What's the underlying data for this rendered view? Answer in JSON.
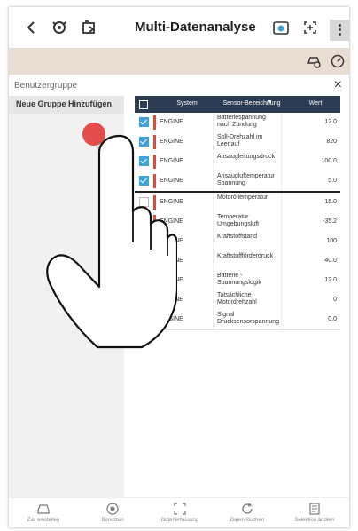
{
  "topbar": {
    "title": "Multi-Datenanalyse",
    "icons": [
      "back-icon",
      "engine-icon",
      "car-icon",
      "vci-icon",
      "screenshot-icon",
      "more-icon"
    ]
  },
  "subbar": {
    "icons": [
      "car-search-icon",
      "speedometer-icon"
    ]
  },
  "panel": {
    "title": "Benutzergruppe",
    "close": "×"
  },
  "group": {
    "add_label": "Neue Gruppe Hinzufügen"
  },
  "table": {
    "columns": {
      "system": "System",
      "sensor": "Sensor-Bezeichnung",
      "value": "Wert"
    },
    "rows": [
      {
        "checked": true,
        "system": "ENGINE",
        "name": "Batteriespannung nach Zündung",
        "value": "12.0"
      },
      {
        "checked": true,
        "system": "ENGINE",
        "name": "Soll-Drehzahl im Leerlauf",
        "value": "820"
      },
      {
        "checked": true,
        "system": "ENGINE",
        "name": "Ansaugleitungsdruck",
        "value": "100.0"
      },
      {
        "checked": true,
        "system": "ENGINE",
        "name": "Ansaugluftemperatur Spannung",
        "value": "5.0"
      },
      {
        "checked": false,
        "system": "ENGINE",
        "name": "Motoröltemperatur",
        "value": "15.0"
      },
      {
        "checked": false,
        "system": "ENGINE",
        "name": "Temperatur Umgebungsluft",
        "value": "-35.2"
      },
      {
        "checked": false,
        "system": "ENGINE",
        "name": "Kraftstoffstand",
        "value": "100"
      },
      {
        "checked": false,
        "system": "ENGINE",
        "name": "Kraftstoffförderdruck",
        "value": "40.0"
      },
      {
        "checked": false,
        "system": "ENGINE",
        "name": "Batterie - Spannungslogik",
        "value": "12.0"
      },
      {
        "checked": false,
        "system": "ENGINE",
        "name": "Tatsächliche Motordrehzahl",
        "value": "0"
      },
      {
        "checked": false,
        "system": "ENGINE",
        "name": "Signal Drucksensorspannung",
        "value": "0.0"
      }
    ]
  },
  "bottomnav": {
    "items": [
      {
        "label": "Ziel einstellen",
        "icon": "car-settings-icon"
      },
      {
        "label": "Benutzen",
        "icon": "record-icon"
      },
      {
        "label": "Datenerfassung",
        "icon": "capture-icon"
      },
      {
        "label": "Daten löschen",
        "icon": "refresh-icon"
      },
      {
        "label": "Selektion ändern",
        "icon": "list-icon"
      }
    ]
  },
  "colors": {
    "header": "#2b3b52",
    "checkbox": "#3fa3db",
    "marker": "#e04a3a",
    "beige": "#e8ddd2",
    "touch": "#e23a3a"
  }
}
